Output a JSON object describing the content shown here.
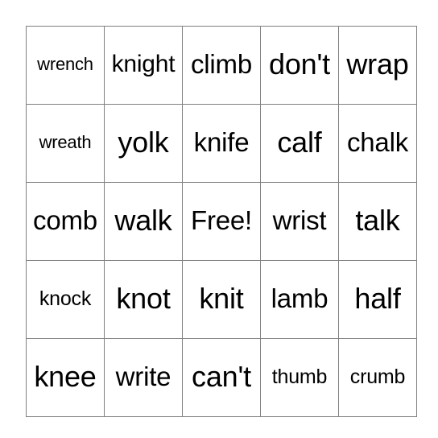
{
  "card": {
    "type": "bingo-card",
    "rows": 5,
    "columns": 5,
    "free_space_label": "Free!",
    "free_space_position": {
      "row": 3,
      "column": 3
    },
    "colors": {
      "background": "#ffffff",
      "cell_background": "#ffffff",
      "border": "#808080",
      "text": "#000000"
    },
    "grid": [
      [
        {
          "text": "wrench",
          "size": "xs"
        },
        {
          "text": "knight",
          "size": "md"
        },
        {
          "text": "climb",
          "size": "lg"
        },
        {
          "text": "don't",
          "size": "xl"
        },
        {
          "text": "wrap",
          "size": "xl"
        }
      ],
      [
        {
          "text": "wreath",
          "size": "xs"
        },
        {
          "text": "yolk",
          "size": "xl"
        },
        {
          "text": "knife",
          "size": "lg"
        },
        {
          "text": "calf",
          "size": "xl"
        },
        {
          "text": "chalk",
          "size": "lg"
        }
      ],
      [
        {
          "text": "comb",
          "size": "lg"
        },
        {
          "text": "walk",
          "size": "xl"
        },
        {
          "text": "Free!",
          "size": "lg"
        },
        {
          "text": "wrist",
          "size": "lg"
        },
        {
          "text": "talk",
          "size": "xl"
        }
      ],
      [
        {
          "text": "knock",
          "size": "sm"
        },
        {
          "text": "knot",
          "size": "xl"
        },
        {
          "text": "knit",
          "size": "xl"
        },
        {
          "text": "lamb",
          "size": "lg"
        },
        {
          "text": "half",
          "size": "xl"
        }
      ],
      [
        {
          "text": "knee",
          "size": "xl"
        },
        {
          "text": "write",
          "size": "lg"
        },
        {
          "text": "can't",
          "size": "xl"
        },
        {
          "text": "thumb",
          "size": "sm"
        },
        {
          "text": "crumb",
          "size": "sm"
        }
      ]
    ]
  }
}
